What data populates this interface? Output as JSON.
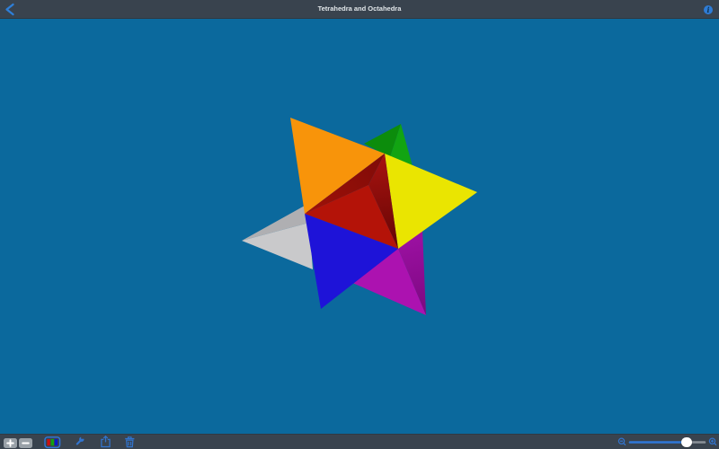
{
  "header": {
    "title": "Tetrahedra and Octahedra",
    "info_glyph": "i",
    "bar_color": "#39434E",
    "accent_color": "#2E7CD6"
  },
  "canvas": {
    "background_color": "#0B699D",
    "figure": "stellated-octahedron",
    "face_colors": {
      "orange": "#F8940A",
      "green_left": "#0C8C0C",
      "green_right": "#12A412",
      "yellow": "#EAE501",
      "red_top_light": "#A01108",
      "red_top_dark": "#7F0B08",
      "red_bottom": "#B41308",
      "red_right_light": "#A81310",
      "red_right_dark": "#640504",
      "gray_top": "#AFAFB2",
      "gray_bottom": "#C9C9CB",
      "blue": "#1E13D8",
      "magenta_left": "#AC12B0",
      "magenta_right_light": "#9A10A0",
      "magenta_right_dark": "#7C0880"
    }
  },
  "toolbar": {
    "bar_color": "#39434E",
    "zoom_in_label": "+",
    "zoom_out_label": "−",
    "icon_color": "#3174CE",
    "slider": {
      "value_percent": 70
    }
  }
}
